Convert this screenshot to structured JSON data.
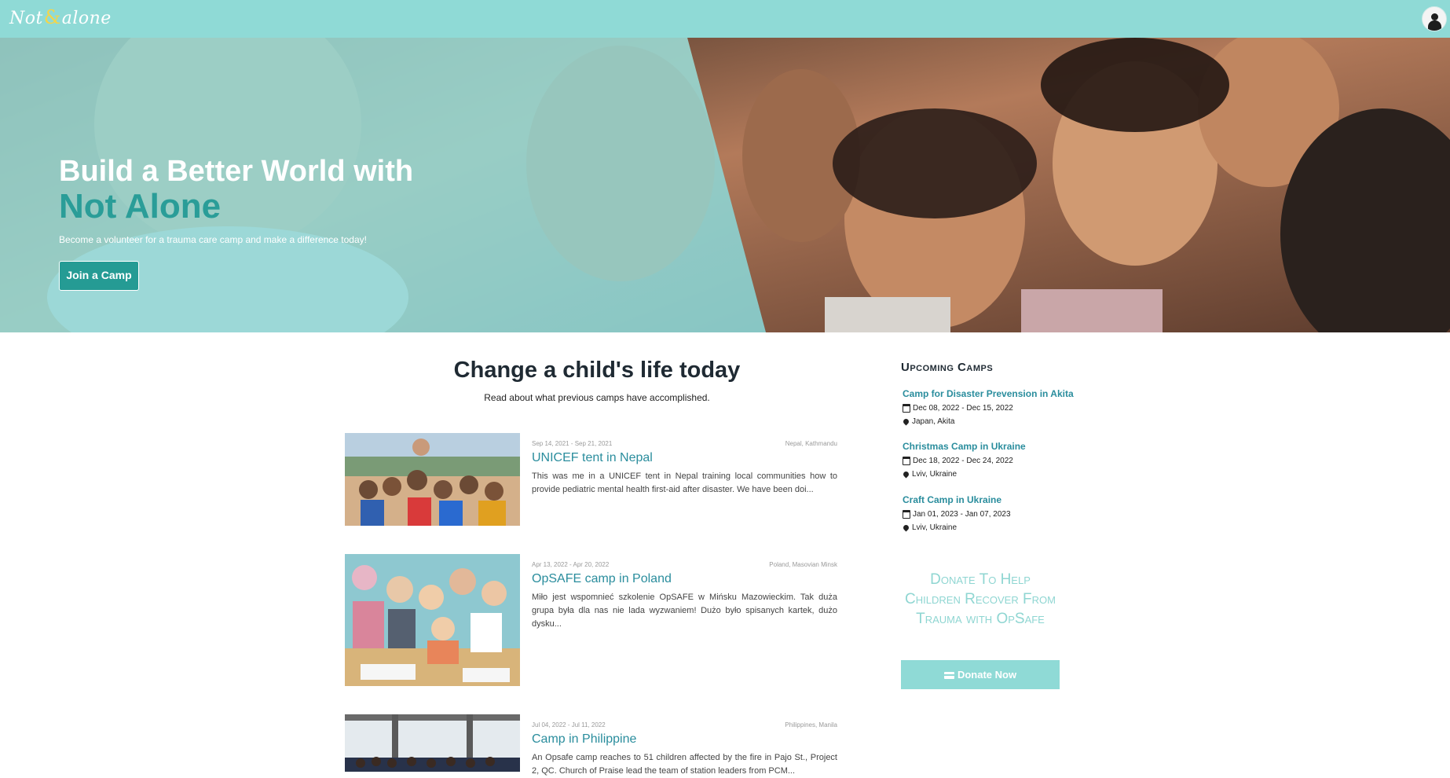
{
  "brand": {
    "left": "Not",
    "mid": "&",
    "right": "alone"
  },
  "colors": {
    "nav": "#8fdad6",
    "accent": "#2a9d98",
    "link": "#2a8d9d",
    "button": "#259b94"
  },
  "hero": {
    "title_line1": "Build a Better World with",
    "title_line2": "Not Alone",
    "subtitle": "Become a volunteer for a trauma care camp and make a difference today!",
    "cta": "Join a Camp"
  },
  "main": {
    "title": "Change a child's life today",
    "subtitle": "Read about what previous camps have accomplished."
  },
  "posts": [
    {
      "dates": "Sep 14, 2021 - Sep 21, 2021",
      "place": "Nepal, Kathmandu",
      "title": "UNICEF tent in Nepal",
      "excerpt": "This was me in a UNICEF tent in Nepal training local communities how to provide pediatric mental health first-aid after disaster. We have been doi..."
    },
    {
      "dates": "Apr 13, 2022 - Apr 20, 2022",
      "place": "Poland, Masovian Minsk",
      "title": "OpSAFE camp in Poland",
      "excerpt": "Miło jest wspomnieć szkolenie OpSAFE w Mińsku Mazowieckim. Tak duża grupa była dla nas nie lada wyzwaniem! Dużo było spisanych kartek, dużo dysku..."
    },
    {
      "dates": "Jul 04, 2022 - Jul 11, 2022",
      "place": "Philippines, Manila",
      "title": "Camp in Philippine",
      "excerpt": "An Opsafe camp reaches to 51 children affected by the fire in Pajo St., Project 2, QC. Church of Praise lead the team of station leaders from PCM..."
    }
  ],
  "sidebar": {
    "heading": "Upcoming Camps",
    "camps": [
      {
        "title": "Camp for Disaster Prevension in Akita",
        "dates": "Dec 08, 2022 - Dec 15, 2022",
        "location": "Japan, Akita"
      },
      {
        "title": "Christmas Camp in Ukraine",
        "dates": "Dec 18, 2022 - Dec 24, 2022",
        "location": "Lviv, Ukraine"
      },
      {
        "title": "Craft Camp in Ukraine",
        "dates": "Jan 01, 2023 - Jan 07, 2023",
        "location": "Lviv, Ukraine"
      }
    ],
    "donate_text": "Donate To Help Children Recover From Trauma with OpSafe",
    "donate_button": "Donate Now"
  },
  "icons": [
    "user-avatar-icon",
    "calendar-icon",
    "map-pin-icon",
    "credit-card-icon"
  ]
}
